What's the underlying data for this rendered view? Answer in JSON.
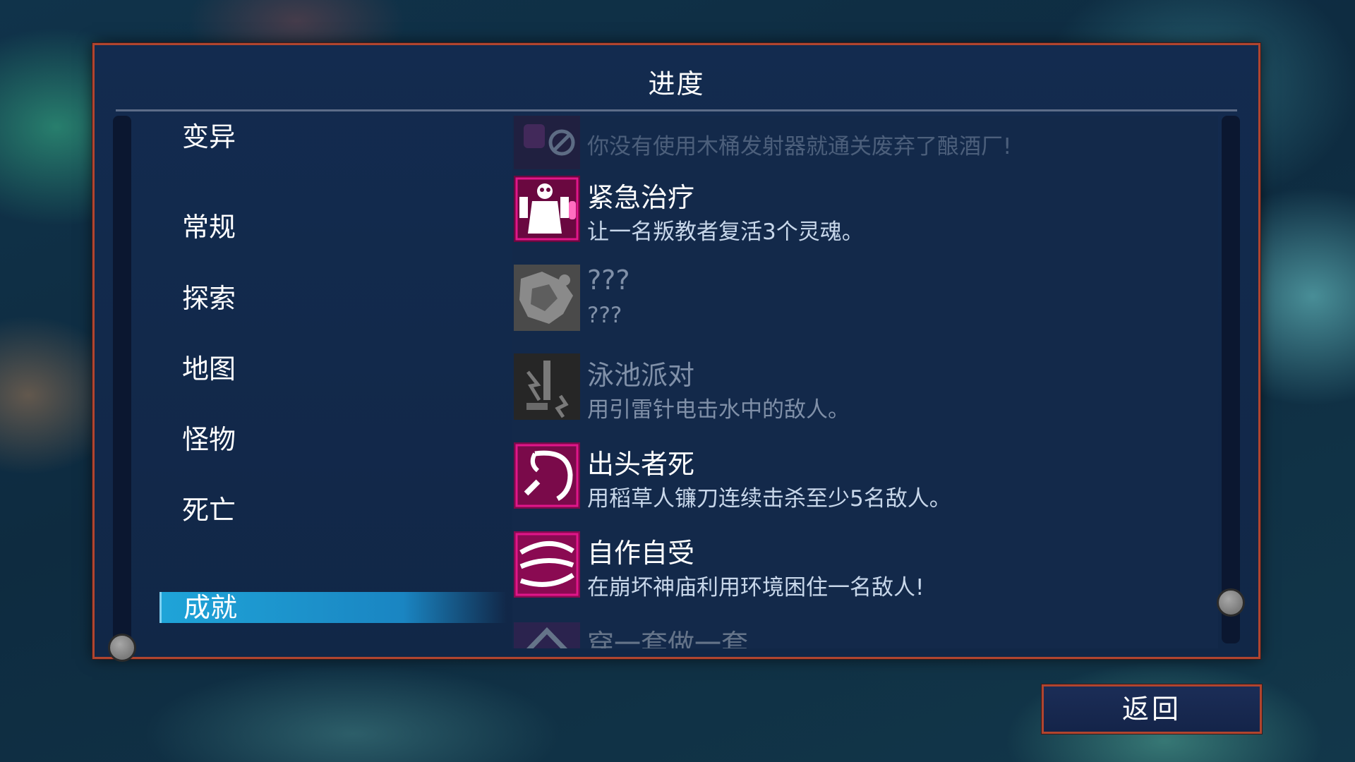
{
  "title": "进度",
  "categories": [
    {
      "label": "变异"
    },
    {
      "label": "常规"
    },
    {
      "label": "探索"
    },
    {
      "label": "地图"
    },
    {
      "label": "怪物"
    },
    {
      "label": "死亡"
    },
    {
      "label": "成就",
      "active": true
    }
  ],
  "achievements": [
    {
      "name": "",
      "desc": "你没有使用木桶发射器就通关废弃了酿酒厂!",
      "icon": "barrel-launcher-icon",
      "state": "faded"
    },
    {
      "name": "紧急治疗",
      "desc": "让一名叛教者复活3个灵魂。",
      "icon": "renegade-revive-icon",
      "state": "unlocked"
    },
    {
      "name": "???",
      "desc": "???",
      "icon": "unknown-achievement-icon",
      "state": "locked"
    },
    {
      "name": "泳池派对",
      "desc": "用引雷针电击水中的敌人。",
      "icon": "lightning-rod-icon",
      "state": "locked"
    },
    {
      "name": "出头者死",
      "desc": "用稻草人镰刀连续击杀至少5名敌人。",
      "icon": "scythe-icon",
      "state": "unlocked"
    },
    {
      "name": "自作自受",
      "desc": "在崩坏神庙利用环境困住一名敌人!",
      "icon": "trap-icon",
      "state": "unlocked"
    },
    {
      "name": "穿一套做一套",
      "desc": "",
      "icon": "outfit-icon",
      "state": "faded"
    }
  ],
  "back_button": {
    "label": "返回"
  },
  "colors": {
    "accent": "#1fa4d8",
    "frame": "#b0452f",
    "icon_magenta": "#e0168a"
  }
}
